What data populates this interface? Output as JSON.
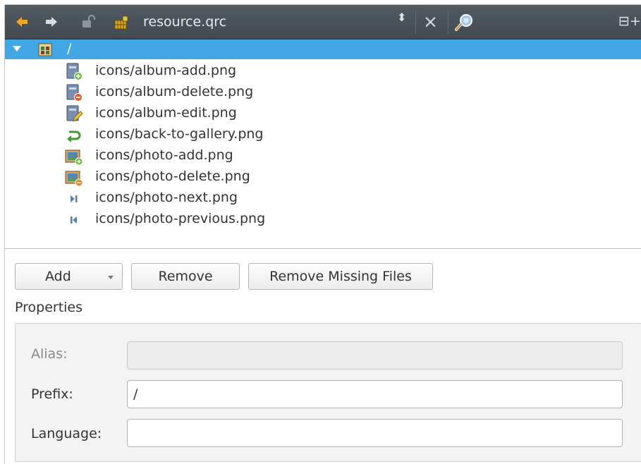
{
  "toolbar": {
    "title": "resource.qrc",
    "updown_glyph": "⬍",
    "close_glyph": "×",
    "split_glyph": "⊟+",
    "icons": [
      "back-arrow-icon",
      "forward-arrow-icon",
      "lock-icon",
      "resource-file-icon",
      "updown-icon",
      "close-icon",
      "locate-icon",
      "split-icon"
    ]
  },
  "tree": {
    "root": {
      "label": "/",
      "expanded": true
    },
    "files": [
      {
        "label": "icons/album-add.png",
        "icon": "album-add-icon"
      },
      {
        "label": "icons/album-delete.png",
        "icon": "album-delete-icon"
      },
      {
        "label": "icons/album-edit.png",
        "icon": "album-edit-icon"
      },
      {
        "label": "icons/back-to-gallery.png",
        "icon": "back-to-gallery-icon"
      },
      {
        "label": "icons/photo-add.png",
        "icon": "photo-add-icon"
      },
      {
        "label": "icons/photo-delete.png",
        "icon": "photo-delete-icon"
      },
      {
        "label": "icons/photo-next.png",
        "icon": "photo-next-icon"
      },
      {
        "label": "icons/photo-previous.png",
        "icon": "photo-previous-icon"
      }
    ]
  },
  "buttons": {
    "add": "Add",
    "remove": "Remove",
    "remove_missing": "Remove Missing Files"
  },
  "properties": {
    "title": "Properties",
    "alias": {
      "label": "Alias:",
      "value": "",
      "enabled": false
    },
    "prefix": {
      "label": "Prefix:",
      "value": "/"
    },
    "language": {
      "label": "Language:",
      "value": ""
    }
  },
  "colors": {
    "selection": "#43a7e6",
    "toolbar": "#4b5259",
    "disabled_text": "#8a8a8a"
  }
}
